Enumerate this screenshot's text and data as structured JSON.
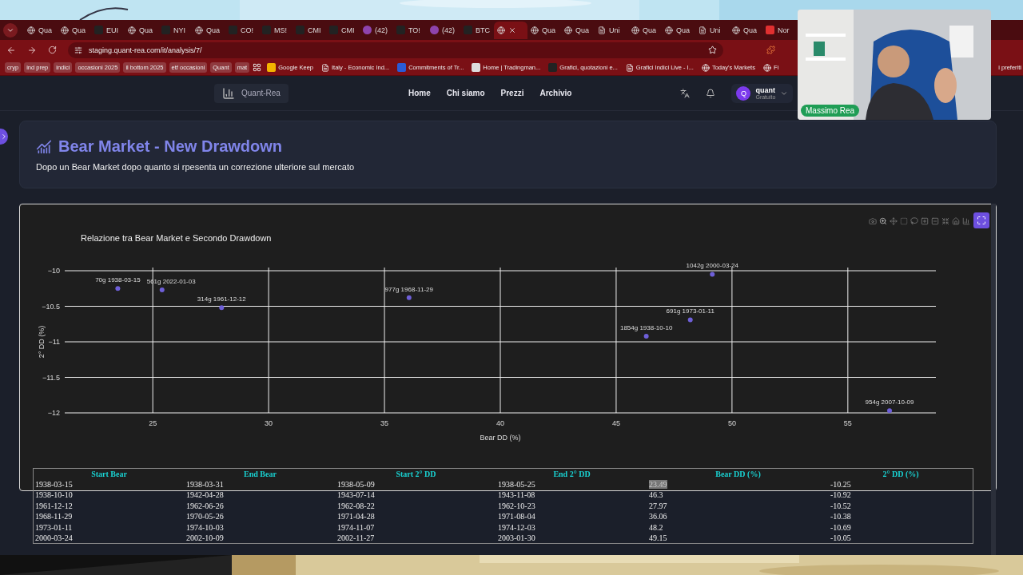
{
  "browser": {
    "tabs": [
      {
        "kind": "globe",
        "label": "Qua",
        "selected": false
      },
      {
        "kind": "globe",
        "label": "Qua",
        "selected": false
      },
      {
        "kind": "tv",
        "label": "EUI",
        "selected": false
      },
      {
        "kind": "globe",
        "label": "Qua",
        "selected": false
      },
      {
        "kind": "tv",
        "label": "NYI",
        "selected": false
      },
      {
        "kind": "globe",
        "label": "Qua",
        "selected": false
      },
      {
        "kind": "tv",
        "label": "CO!",
        "selected": false
      },
      {
        "kind": "tv",
        "label": "MS!",
        "selected": false
      },
      {
        "kind": "tv",
        "label": "CMI",
        "selected": false
      },
      {
        "kind": "tv",
        "label": "CMI",
        "selected": false
      },
      {
        "kind": "badge",
        "label": "(42)",
        "selected": false
      },
      {
        "kind": "tv",
        "label": "TO!",
        "selected": false
      },
      {
        "kind": "badge",
        "label": "(42)",
        "selected": false
      },
      {
        "kind": "tv",
        "label": "BTC",
        "selected": false
      },
      {
        "kind": "globe",
        "selected": true
      },
      {
        "kind": "globe",
        "label": "Qua",
        "selected": false
      },
      {
        "kind": "globe",
        "label": "Qua",
        "selected": false
      },
      {
        "kind": "doc",
        "label": "Uni",
        "selected": false
      },
      {
        "kind": "globe",
        "label": "Qua",
        "selected": false
      },
      {
        "kind": "globe",
        "label": "Qua",
        "selected": false
      },
      {
        "kind": "doc",
        "label": "Uni",
        "selected": false
      },
      {
        "kind": "globe",
        "label": "Qua",
        "selected": false
      },
      {
        "kind": "red",
        "label": "Nor",
        "selected": false
      }
    ],
    "url": "staging.quant-rea.com/it/analysis/7/",
    "bookmarks": [
      {
        "kind": "folder",
        "label": "cryp"
      },
      {
        "kind": "folder",
        "label": "ind prep"
      },
      {
        "kind": "folder",
        "label": "indici"
      },
      {
        "kind": "folder",
        "label": "occasioni 2025"
      },
      {
        "kind": "folder",
        "label": "il bottom 2025"
      },
      {
        "kind": "folder",
        "label": "etf occasioni"
      },
      {
        "kind": "folder",
        "label": "Quant"
      },
      {
        "kind": "folder",
        "label": "mat"
      },
      {
        "kind": "apps"
      },
      {
        "kind": "keep",
        "label": "Google Keep"
      },
      {
        "kind": "doc",
        "label": "Italy - Economic Ind..."
      },
      {
        "kind": "b",
        "label": "Commitments of Tr..."
      },
      {
        "kind": "tm",
        "label": "Home | Tradingman..."
      },
      {
        "kind": "tv",
        "label": "Grafici, quotazioni e..."
      },
      {
        "kind": "doc",
        "label": "Grafici Indici Live - I..."
      },
      {
        "kind": "globe",
        "label": "Today's Markets"
      },
      {
        "kind": "globe",
        "label": "Fi"
      }
    ],
    "bookmarks_end": "i preferiti"
  },
  "nav": {
    "brand": "Quant-Rea",
    "links": [
      "Home",
      "Chi siamo",
      "Prezzi",
      "Archivio"
    ],
    "user": {
      "initial": "Q",
      "name": "quant",
      "plan": "Gratuito"
    }
  },
  "header": {
    "title": "Bear Market - New Drawdown",
    "subtitle": "Dopo un Bear Market dopo quanto si rpesenta un correzione ulteriore sul mercato"
  },
  "chart": {
    "chart_data": {
      "type": "scatter",
      "title": "Relazione tra Bear Market e Secondo Drawdown",
      "xlabel": "Bear DD (%)",
      "ylabel": "2° DD (%)",
      "x": [
        23.49,
        25.4,
        27.97,
        36.06,
        49.15,
        48.2,
        46.3,
        56.8
      ],
      "grid": true,
      "series": [
        {
          "color": "#6e5fd8",
          "values": [
            -10.25,
            -10.27,
            -10.52,
            -10.38,
            -10.05,
            -10.69,
            -10.92,
            -11.97
          ]
        }
      ],
      "value_labels": [
        "70g 1938-03-15",
        "561g 2022-01-03",
        "314g 1961-12-12",
        "977g 1968-11-29",
        "1042g 2000-03-24",
        "691g 1973-01-11",
        "1854g 1938-10-10",
        "954g 2007-10-09"
      ],
      "xlim": [
        21.2,
        58.8
      ],
      "ylim": [
        -12,
        -10
      ],
      "xticks": [
        25,
        30,
        35,
        40,
        45,
        50,
        55
      ],
      "yticks": [
        {
          "value": -10,
          "label": "−10"
        },
        {
          "value": -10.5,
          "label": "−10.5"
        },
        {
          "value": -11,
          "label": "−11"
        },
        {
          "value": -11.5,
          "label": "−11.5"
        },
        {
          "value": -12,
          "label": "−12"
        }
      ]
    }
  },
  "table": {
    "columns": [
      "Start Bear",
      "End Bear",
      "Start 2° DD",
      "End 2° DD",
      "Bear DD (%)",
      "2° DD (%)"
    ],
    "rows": [
      [
        {
          "text": "1938-03-15",
          "selected": false
        },
        {
          "text": "1938-03-31",
          "selected": false
        },
        {
          "text": "1938-05-09",
          "selected": false
        },
        {
          "text": "1938-05-25",
          "selected": false
        },
        {
          "text": "23.49",
          "selected": true
        },
        {
          "text": "-10.25",
          "selected": false
        }
      ],
      [
        {
          "text": "1938-10-10",
          "selected": false
        },
        {
          "text": "1942-04-28",
          "selected": false
        },
        {
          "text": "1943-07-14",
          "selected": false
        },
        {
          "text": "1943-11-08",
          "selected": false
        },
        {
          "text": "46.3",
          "selected": false
        },
        {
          "text": "-10.92",
          "selected": false
        }
      ],
      [
        {
          "text": "1961-12-12",
          "selected": false
        },
        {
          "text": "1962-06-26",
          "selected": false
        },
        {
          "text": "1962-08-22",
          "selected": false
        },
        {
          "text": "1962-10-23",
          "selected": false
        },
        {
          "text": "27.97",
          "selected": false
        },
        {
          "text": "-10.52",
          "selected": false
        }
      ],
      [
        {
          "text": "1968-11-29",
          "selected": false
        },
        {
          "text": "1970-05-26",
          "selected": false
        },
        {
          "text": "1971-04-28",
          "selected": false
        },
        {
          "text": "1971-08-04",
          "selected": false
        },
        {
          "text": "36.06",
          "selected": false
        },
        {
          "text": "-10.38",
          "selected": false
        }
      ],
      [
        {
          "text": "1973-01-11",
          "selected": false
        },
        {
          "text": "1974-10-03",
          "selected": false
        },
        {
          "text": "1974-11-07",
          "selected": false
        },
        {
          "text": "1974-12-03",
          "selected": false
        },
        {
          "text": "48.2",
          "selected": false
        },
        {
          "text": "-10.69",
          "selected": false
        }
      ],
      [
        {
          "text": "2000-03-24",
          "selected": false
        },
        {
          "text": "2002-10-09",
          "selected": false
        },
        {
          "text": "2002-11-27",
          "selected": false
        },
        {
          "text": "2003-01-30",
          "selected": false
        },
        {
          "text": "49.15",
          "selected": false
        },
        {
          "text": "-10.05",
          "selected": false
        }
      ]
    ]
  },
  "webcam": {
    "kind": "picture",
    "name": "Massimo Rea"
  }
}
